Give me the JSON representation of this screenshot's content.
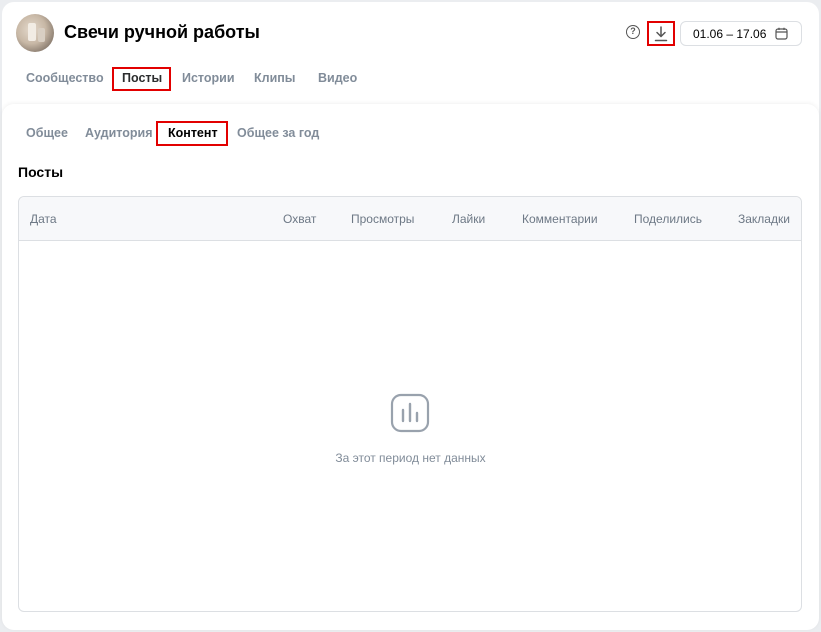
{
  "header": {
    "title": "Свечи ручной работы",
    "help_icon": "?",
    "date_range": "01.06 – 17.06"
  },
  "main_tabs": [
    {
      "label": "Сообщество",
      "active": false
    },
    {
      "label": "Посты",
      "active": true
    },
    {
      "label": "Истории",
      "active": false
    },
    {
      "label": "Клипы",
      "active": false
    },
    {
      "label": "Видео",
      "active": false
    }
  ],
  "sub_tabs": [
    {
      "label": "Общее",
      "active": false
    },
    {
      "label": "Аудитория",
      "active": false
    },
    {
      "label": "Контент",
      "active": true
    },
    {
      "label": "Общее за год",
      "active": false
    }
  ],
  "section_title": "Посты",
  "table": {
    "columns": [
      "Дата",
      "Охват",
      "Просмотры",
      "Лайки",
      "Комментарии",
      "Поделились",
      "Закладки"
    ],
    "rows": []
  },
  "empty_state": "За этот период нет данных",
  "colors": {
    "highlight": "#e20000",
    "inactive_tab": "#818c99",
    "border": "#dcdfe3"
  },
  "icons": [
    "avatar",
    "help-icon",
    "download-icon",
    "calendar-icon",
    "bar-chart-icon"
  ]
}
